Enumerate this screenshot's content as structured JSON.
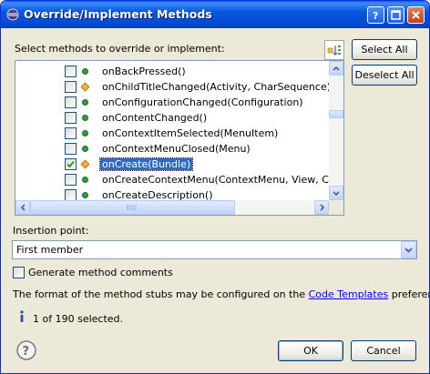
{
  "window": {
    "title": "Override/Implement Methods"
  },
  "prompt_label": "Select methods to override or implement:",
  "buttons": {
    "select_all": "Select All",
    "deselect_all": "Deselect All",
    "ok": "OK",
    "cancel": "Cancel"
  },
  "methods": [
    {
      "name": "onBackPressed()",
      "checked": false,
      "icon": "public-method-icon"
    },
    {
      "name": "onChildTitleChanged(Activity, CharSequence)",
      "checked": false,
      "icon": "protected-method-icon"
    },
    {
      "name": "onConfigurationChanged(Configuration)",
      "checked": false,
      "icon": "public-method-icon"
    },
    {
      "name": "onContentChanged()",
      "checked": false,
      "icon": "public-method-icon"
    },
    {
      "name": "onContextItemSelected(MenuItem)",
      "checked": false,
      "icon": "public-method-icon"
    },
    {
      "name": "onContextMenuClosed(Menu)",
      "checked": false,
      "icon": "public-method-icon"
    },
    {
      "name": "onCreate(Bundle)",
      "checked": true,
      "selected": true,
      "icon": "protected-method-icon"
    },
    {
      "name": "onCreateContextMenu(ContextMenu, View, ContextMenuInfo)",
      "checked": false,
      "icon": "public-method-icon"
    },
    {
      "name": "onCreateDescription()",
      "checked": false,
      "icon": "public-method-icon"
    }
  ],
  "insertion": {
    "label": "Insertion point:",
    "value": "First member"
  },
  "generate_comments": {
    "label": "Generate method comments",
    "checked": false
  },
  "format_note": {
    "before": "The format of the method stubs may be configured on the ",
    "link": "Code Templates",
    "after": " preference page."
  },
  "status": {
    "text": "1 of 190 selected."
  },
  "colors": {
    "title_bar": "#0054e3",
    "selection": "#316ac5",
    "public_method": "#2e9e3c",
    "protected_method": "#f4b43c"
  }
}
